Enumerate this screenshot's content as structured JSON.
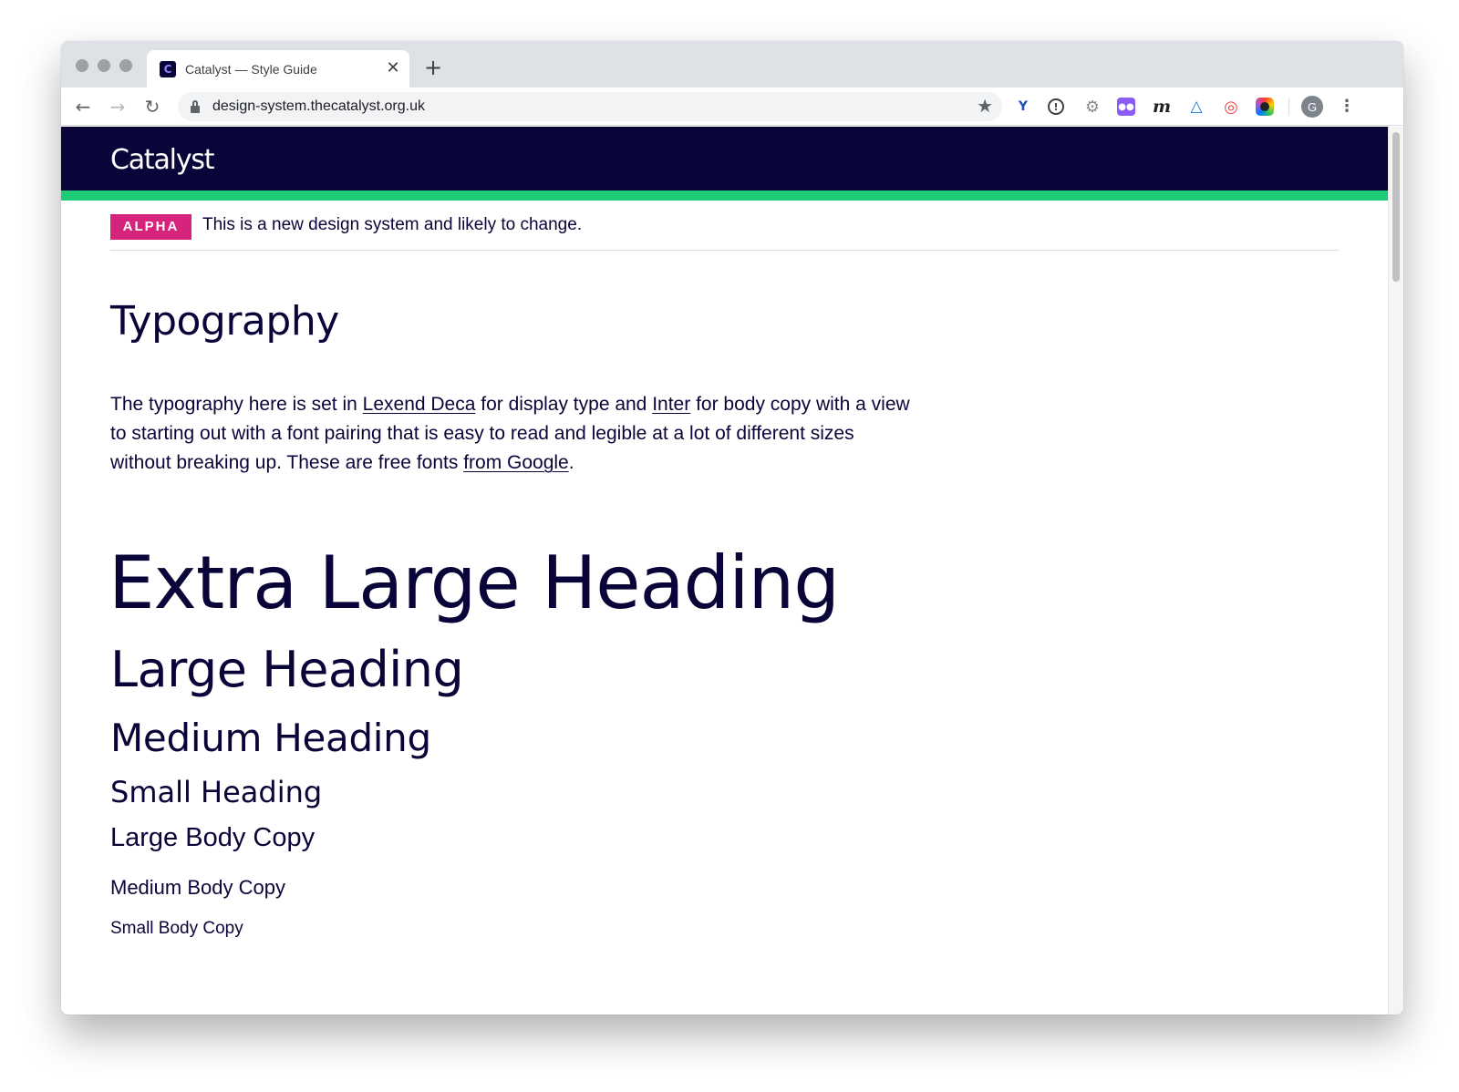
{
  "browser": {
    "tab": {
      "title": "Catalyst — Style Guide",
      "favicon_letter": "C",
      "close_glyph": "✕"
    },
    "new_tab_glyph": "+",
    "nav": {
      "back_glyph": "←",
      "forward_glyph": "→",
      "reload_glyph": "↻"
    },
    "omnibox": {
      "url": "design-system.thecatalyst.org.uk",
      "star_glyph": "★"
    },
    "extensions": [
      {
        "name": "extension-y-icon",
        "glyph": "Y"
      },
      {
        "name": "extension-info-icon",
        "glyph": "!"
      },
      {
        "name": "extension-gear-icon",
        "glyph": "⚙"
      },
      {
        "name": "extension-purple-icon",
        "glyph": "●●"
      },
      {
        "name": "extension-m-icon",
        "glyph": "m"
      },
      {
        "name": "extension-triangle-icon",
        "glyph": "△"
      },
      {
        "name": "extension-red-swirl-icon",
        "glyph": "◎"
      },
      {
        "name": "extension-color-picker-icon",
        "glyph": ""
      }
    ],
    "profile_initial": "G",
    "menu_glyph": "⋮"
  },
  "site": {
    "logo": "Catalyst",
    "phase_banner": {
      "tag": "ALPHA",
      "text": "This is a new design system and likely to change."
    }
  },
  "page": {
    "title": "Typography",
    "intro": {
      "text_1": "The typography here is set in ",
      "link_1": "Lexend Deca",
      "text_2": " for display type and ",
      "link_2": "Inter",
      "text_3": " for body copy with a view to starting out with a font pairing that is easy to read and legible at a lot of different sizes without breaking up. These are free fonts ",
      "link_3": "from Google",
      "text_4": "."
    },
    "samples": {
      "extra_large_heading": "Extra Large Heading",
      "large_heading": "Large Heading",
      "medium_heading": "Medium Heading",
      "small_heading": "Small Heading",
      "large_body": "Large Body Copy",
      "medium_body": "Medium Body Copy",
      "small_body": "Small Body Copy"
    }
  },
  "colors": {
    "header_bg": "#0a0538",
    "accent_green": "#1ecc78",
    "alpha_tag": "#d6247d",
    "text": "#0a0538"
  }
}
